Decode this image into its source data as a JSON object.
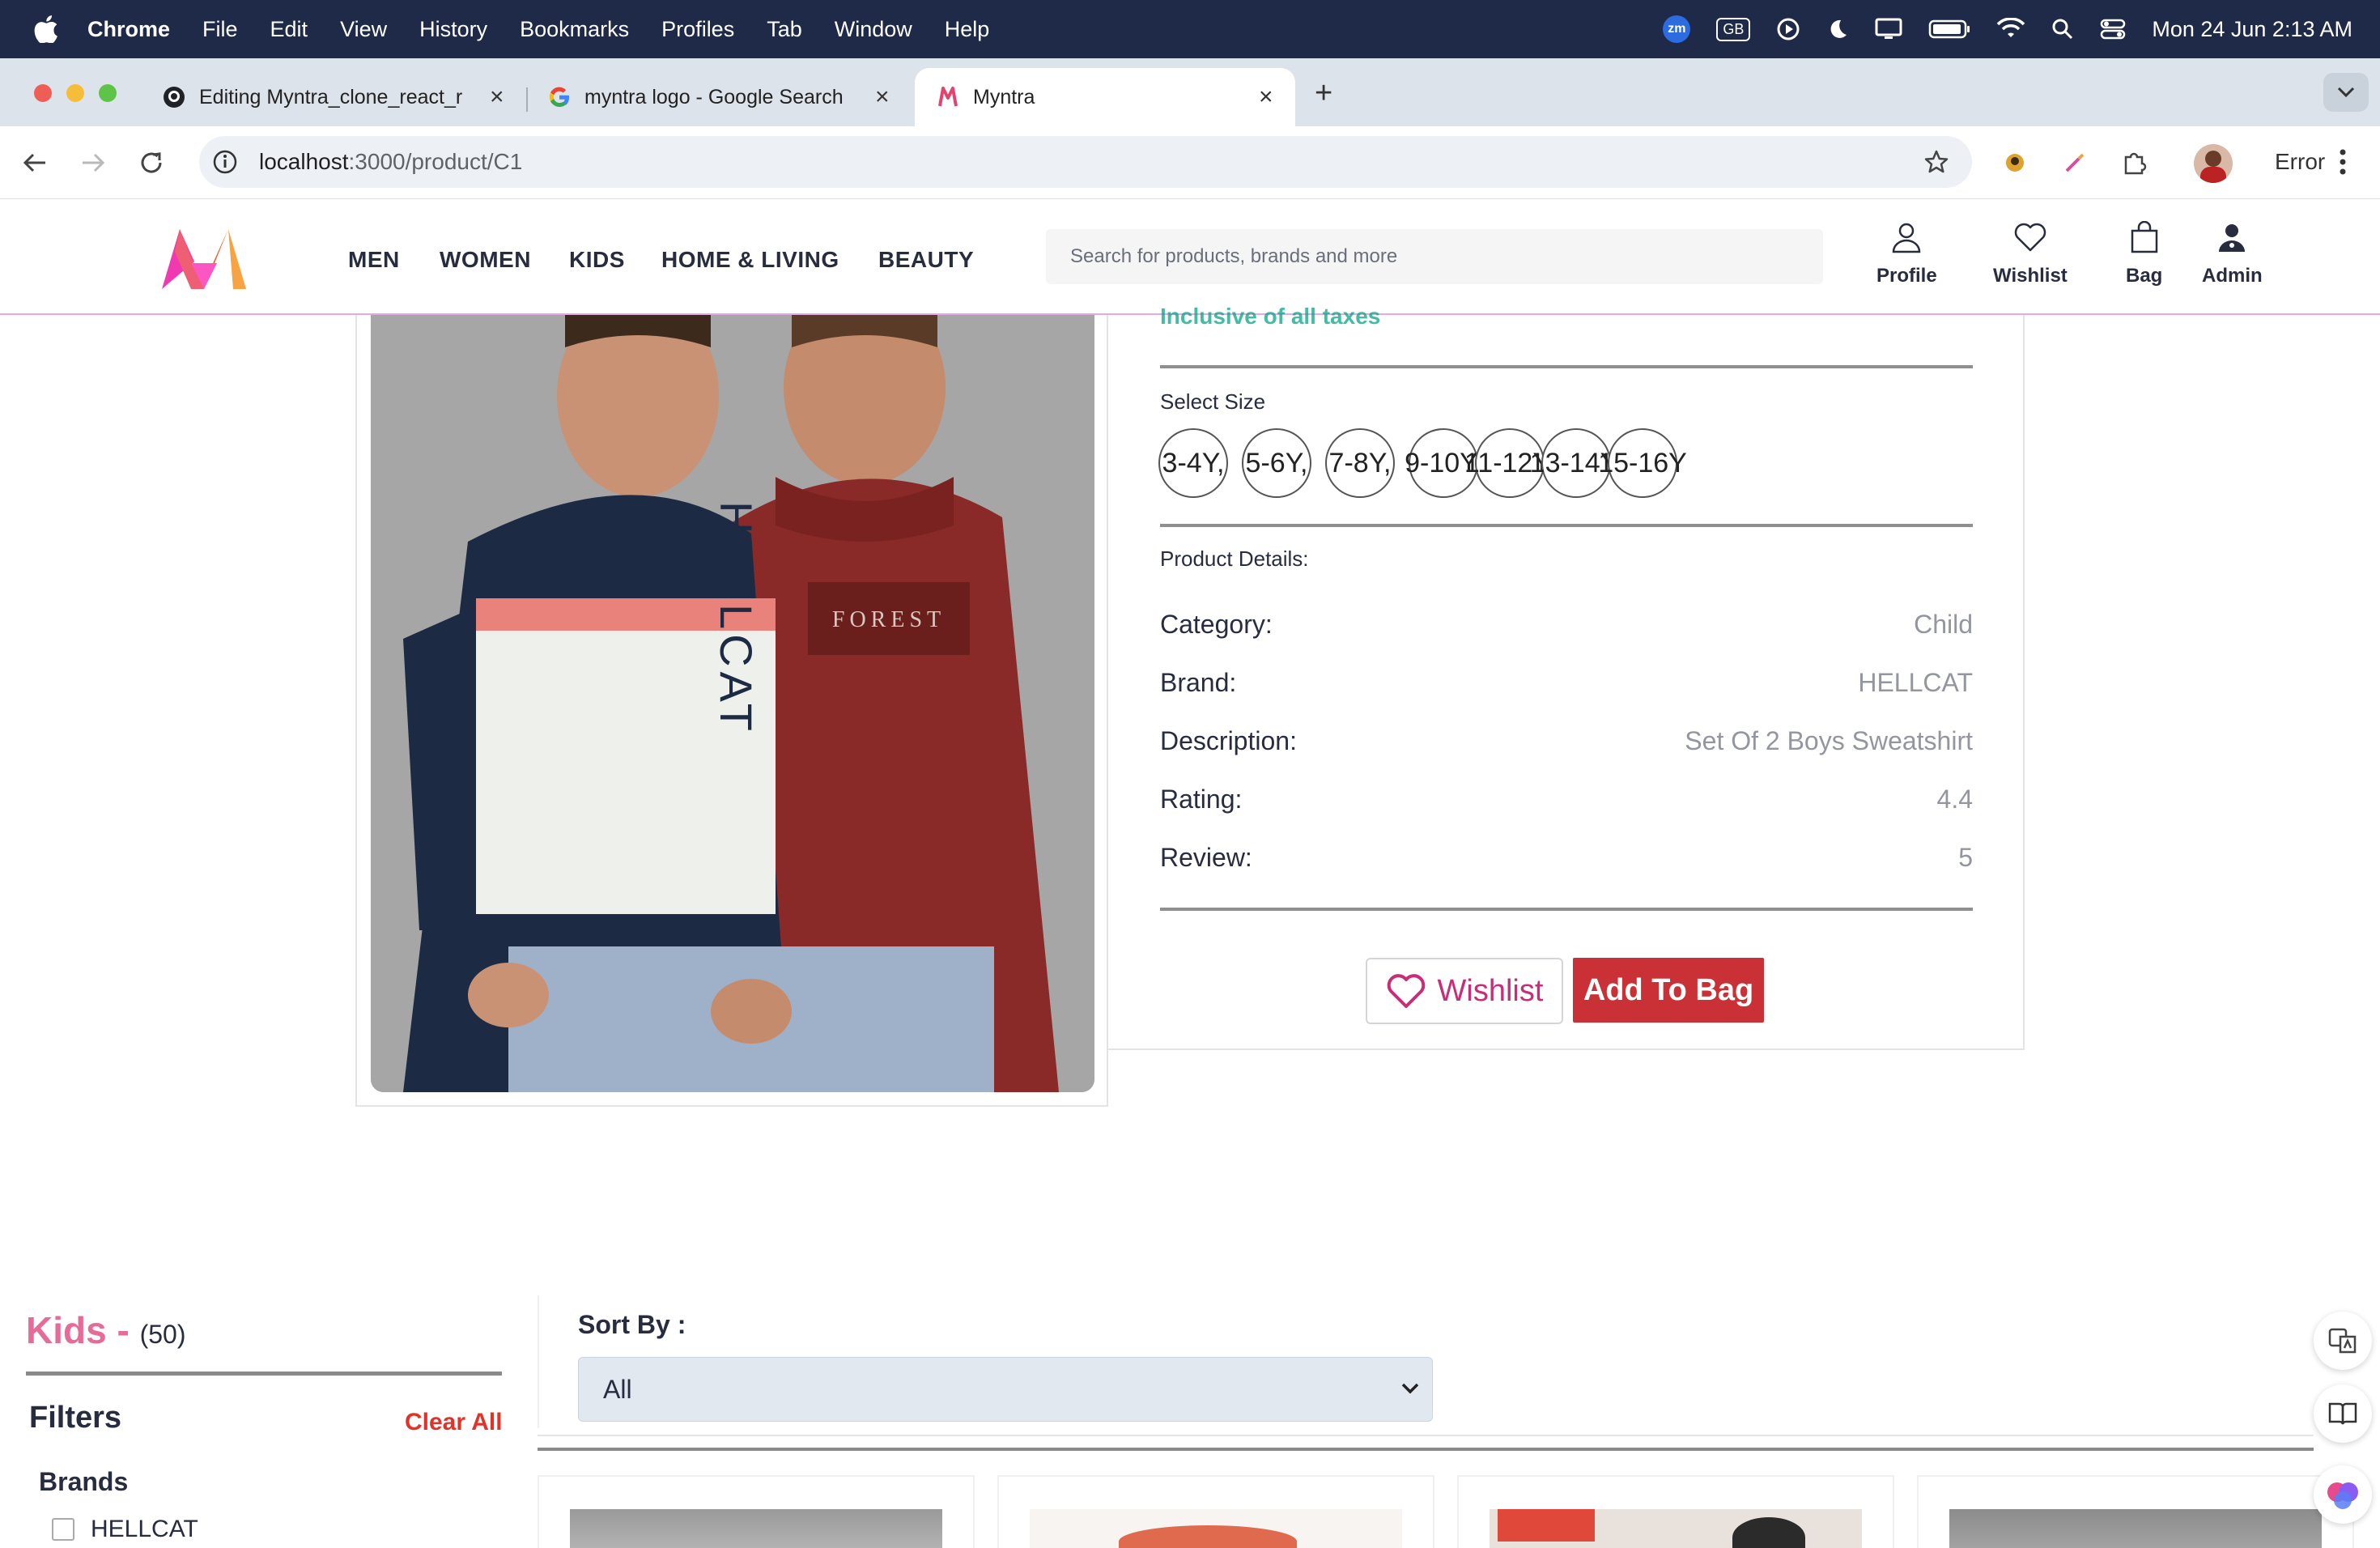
{
  "menubar": {
    "app": "Chrome",
    "items": [
      "File",
      "Edit",
      "View",
      "History",
      "Bookmarks",
      "Profiles",
      "Tab",
      "Window",
      "Help"
    ],
    "zoom_badge": "zm",
    "keyboard": "GB",
    "datetime": "Mon 24 Jun  2:13 AM"
  },
  "tabs": [
    {
      "title": "Editing Myntra_clone_react_r"
    },
    {
      "title": "myntra logo - Google Search"
    },
    {
      "title": "Myntra"
    }
  ],
  "toolbar": {
    "url_host": "localhost",
    "url_path": ":3000/product/C1",
    "profile_status": "Error"
  },
  "header": {
    "nav": [
      "MEN",
      "WOMEN",
      "KIDS",
      "HOME & LIVING",
      "BEAUTY"
    ],
    "search_placeholder": "Search for products, brands and more",
    "actions": {
      "profile": "Profile",
      "wishlist": "Wishlist",
      "bag": "Bag",
      "admin": "Admin"
    }
  },
  "product": {
    "tax_note": "Inclusive of all taxes",
    "select_size_label": "Select Size",
    "sizes": [
      "3-4Y,",
      "5-6Y,",
      "7-8Y,",
      "9-10Y,",
      "11-12Y,",
      "13-14Y,",
      "15-16Y"
    ],
    "details_label": "Product Details:",
    "details": [
      {
        "key": "Category:",
        "value": "Child"
      },
      {
        "key": "Brand:",
        "value": "HELLCAT"
      },
      {
        "key": "Description:",
        "value": "Set Of 2 Boys Sweatshirt"
      },
      {
        "key": "Rating:",
        "value": "4.4"
      },
      {
        "key": "Review:",
        "value": "5"
      }
    ],
    "image_prints": {
      "left": "HELLCAT",
      "right": "FOREST"
    },
    "wishlist_label": "Wishlist",
    "add_to_bag_label": "Add To Bag"
  },
  "listing": {
    "title": "Kids -",
    "count": "(50)",
    "filters_label": "Filters",
    "clear_all_label": "Clear All",
    "brands_label": "Brands",
    "brand_options": [
      "HELLCAT"
    ],
    "sort_label": "Sort By :",
    "sort_value": "All"
  },
  "colors": {
    "accent_pink": "#e56c99",
    "add_to_bag": "#c93136",
    "wishlist": "#c62e78",
    "tax_green": "#03a685"
  }
}
